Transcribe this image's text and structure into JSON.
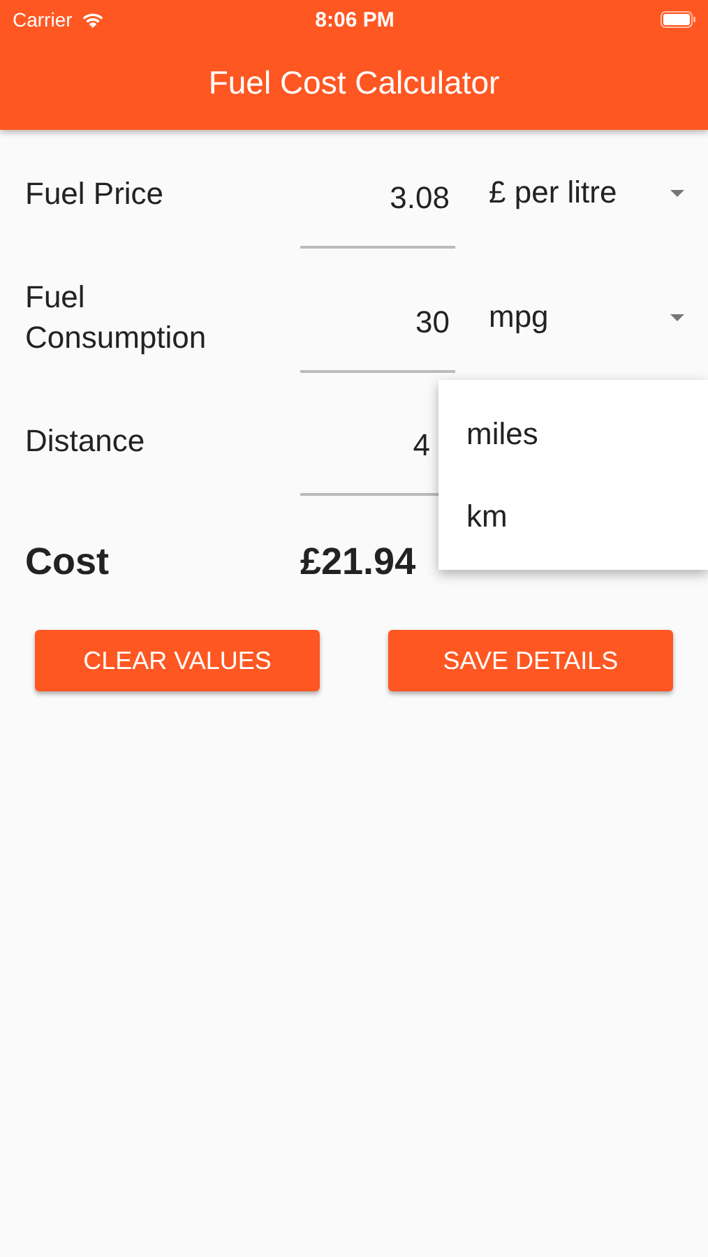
{
  "status_bar": {
    "carrier": "Carrier",
    "time": "8:06 PM"
  },
  "app_bar": {
    "title": "Fuel Cost Calculator"
  },
  "rows": [
    {
      "label": "Fuel Price",
      "value": "3.08",
      "unit": "£ per litre"
    },
    {
      "label": "Fuel Consumption",
      "value": "30",
      "unit": "mpg"
    },
    {
      "label": "Distance",
      "value": "4"
    }
  ],
  "cost": {
    "label": "Cost",
    "value": "£21.94"
  },
  "menu": {
    "items": [
      {
        "label": "miles",
        "selected": false
      },
      {
        "label": "km",
        "selected": false
      }
    ]
  },
  "buttons": [
    {
      "label": "CLEAR VALUES"
    },
    {
      "label": "SAVE DETAILS"
    }
  ]
}
